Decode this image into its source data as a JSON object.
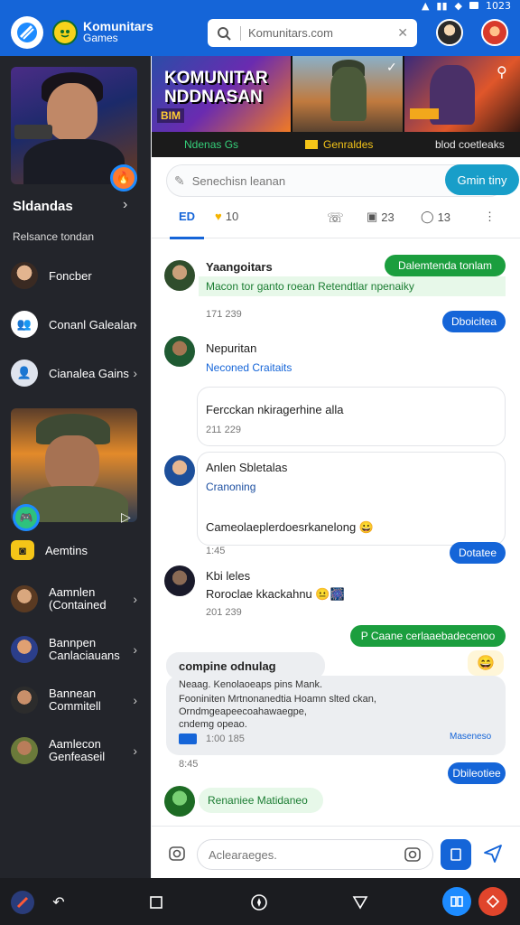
{
  "status_bar": {
    "time": "1023"
  },
  "header": {
    "brand_name": "Komunitars",
    "brand_sub": "Games",
    "search_value": "Komunitars.com",
    "search_placeholder": "Search"
  },
  "sidebar": {
    "section_title": "Sldandas",
    "section_sub": "Relsance tondan",
    "items": [
      {
        "label": "Foncber"
      },
      {
        "label": "Conanl Galealan"
      },
      {
        "label": "Cianalea Gains"
      }
    ],
    "items2": [
      {
        "label": "Aemtins"
      },
      {
        "label": "Aamnlen (Contained"
      },
      {
        "label": "Bannpen Canlaciauans"
      },
      {
        "label": "Bannean Commitell"
      },
      {
        "label": "Aamlecon Genfeaseil"
      }
    ]
  },
  "banner": {
    "title_line1": "KOMUNITAR",
    "title_line2": "NDDNASAN",
    "tag": "BIM",
    "strip1": "Ndenas Gs",
    "strip2": "Genraldes",
    "strip3": "blod coetleaks"
  },
  "compose": {
    "placeholder": "Senechisn leanan",
    "button": "Gmin tiny"
  },
  "tabs": [
    {
      "label": "ED",
      "active": true
    },
    {
      "label": "10"
    },
    {
      "label": ""
    },
    {
      "label": "23"
    },
    {
      "label": "13"
    }
  ],
  "messages": [
    {
      "name": "Yaangoitars",
      "pill": "Dalemtenda tonlam",
      "text": "Macon tor ganto roean  Retendtlar npenaiky",
      "time": "171 239",
      "reply": "Dboicitea"
    },
    {
      "name": "Nepuritan",
      "text": "Neconed Craitaits",
      "sub": "Fercckan nkiragerhine alla",
      "time": "211 229"
    },
    {
      "name": "Anlen Sbletalas",
      "text": "Cranoning",
      "sub": "Cameolaeplerdoesrkanelong",
      "time": "1:45",
      "reply": "Dotatee"
    },
    {
      "name": "Kbi leles",
      "text": "Roroclae kkackahnu",
      "time": "201 239",
      "pill": "P Caane cerlaaebadecenoo"
    },
    {
      "title": "compine odnulag",
      "line1": "Neaag. Kenolaoeaps pins Mank.",
      "line2": "Fooniniten Mrtnonanedtia Hoamn slted ckan,",
      "line3": "Orndmgeapeecoahawaegpe,",
      "line4": "cndemg opeao.",
      "time": "1:00 185",
      "link": "Maseneso",
      "time2": "8:45",
      "reply": "Dbileotiee"
    },
    {
      "green_text": "Renaniee Matidaneo"
    }
  ],
  "input": {
    "placeholder": "Aclearaeges."
  },
  "colors": {
    "primary": "#1565d8",
    "green": "#1b9e3e",
    "sidebar": "#23252b"
  }
}
